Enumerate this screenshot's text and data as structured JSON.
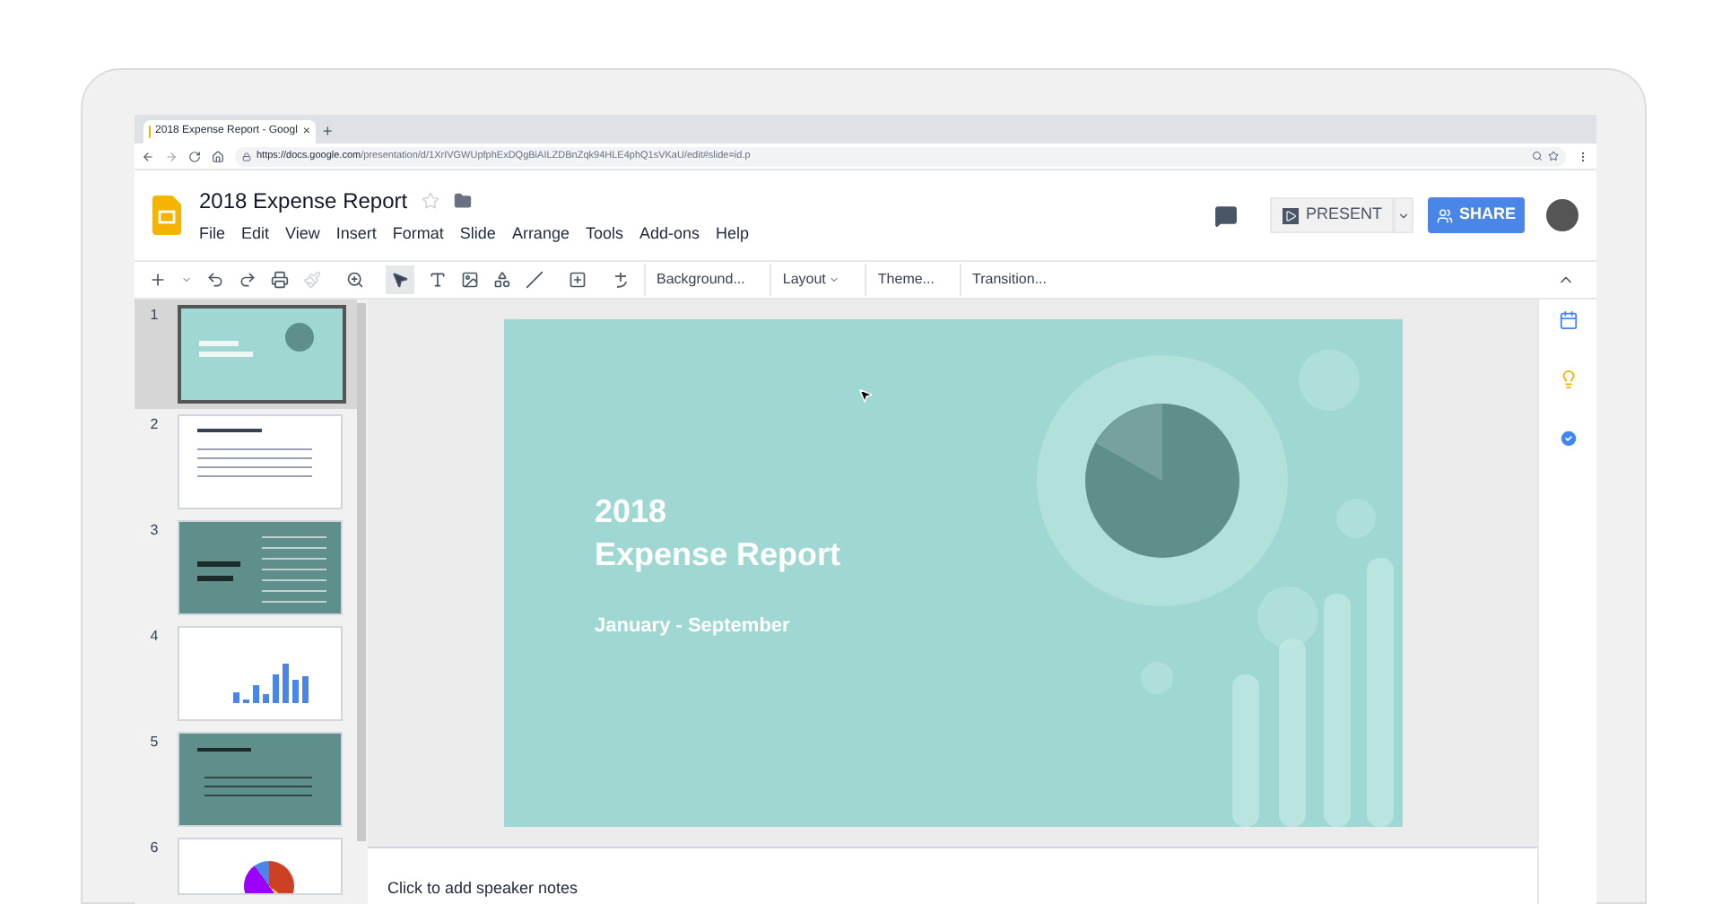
{
  "browser": {
    "tab_title": "2018 Expense Report - Googl",
    "tab_close": "×",
    "new_tab": "+",
    "url_host": "https://docs.google.com",
    "url_path": "/presentation/d/1XrIVGWUpfphExDQgBiAILZDBnZqk94HLE4phQ1sVKaU/edit#slide=id.p"
  },
  "document": {
    "title": "2018 Expense Report",
    "menu": [
      "File",
      "Edit",
      "View",
      "Insert",
      "Format",
      "Slide",
      "Arrange",
      "Tools",
      "Add-ons",
      "Help"
    ],
    "present_label": "PRESENT",
    "share_label": "SHARE"
  },
  "toolbar": {
    "text_buttons": [
      {
        "label": "Background...",
        "dropdown": false
      },
      {
        "label": "Layout",
        "dropdown": true
      },
      {
        "label": "Theme...",
        "dropdown": false
      },
      {
        "label": "Transition...",
        "dropdown": false
      }
    ]
  },
  "slides": [
    {
      "number": "1",
      "kind": "title",
      "selected": true
    },
    {
      "number": "2",
      "kind": "text",
      "selected": false
    },
    {
      "number": "3",
      "kind": "table",
      "selected": false
    },
    {
      "number": "4",
      "kind": "chart",
      "selected": false
    },
    {
      "number": "5",
      "kind": "statement",
      "selected": false
    },
    {
      "number": "6",
      "kind": "pie",
      "selected": false
    }
  ],
  "current_slide": {
    "year": "2018",
    "title": "Expense Report",
    "subtitle": "January - September"
  },
  "speaker_notes": {
    "placeholder": "Click to add speaker notes"
  }
}
